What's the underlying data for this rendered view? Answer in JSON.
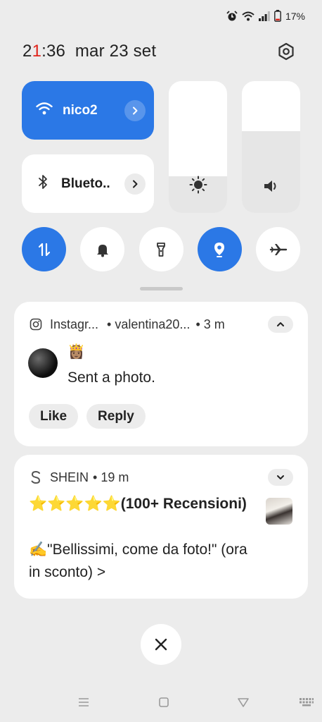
{
  "status": {
    "battery": "17%"
  },
  "header": {
    "time_hour_first": "2",
    "time_hour_second": "1",
    "time_rest": ":36",
    "date": "mar 23 set"
  },
  "quick": {
    "wifi_label": "nico2",
    "bluetooth_label": "Blueto..",
    "brightness_level": 0.28,
    "volume_level": 0.62,
    "toggles": [
      {
        "name": "mobile-data",
        "on": true
      },
      {
        "name": "silent",
        "on": false
      },
      {
        "name": "flashlight",
        "on": false
      },
      {
        "name": "location",
        "on": true
      },
      {
        "name": "airplane",
        "on": false
      }
    ]
  },
  "notifications": {
    "instagram": {
      "app": "Instagr...",
      "sender": "• valentina20...",
      "time": "• 3 m",
      "emoji": "👸🏽",
      "text": "Sent a photo.",
      "like_label": "Like",
      "reply_label": "Reply"
    },
    "shein": {
      "app": "SHEIN",
      "time": "• 19 m",
      "title": "⭐⭐⭐⭐⭐(100+ Recensioni)",
      "body": "✍️\"Bellissimi, come da foto!\" (ora in sconto) >"
    }
  },
  "colors": {
    "accent": "#2b78e6",
    "background": "#ececec",
    "card": "#ffffff"
  }
}
